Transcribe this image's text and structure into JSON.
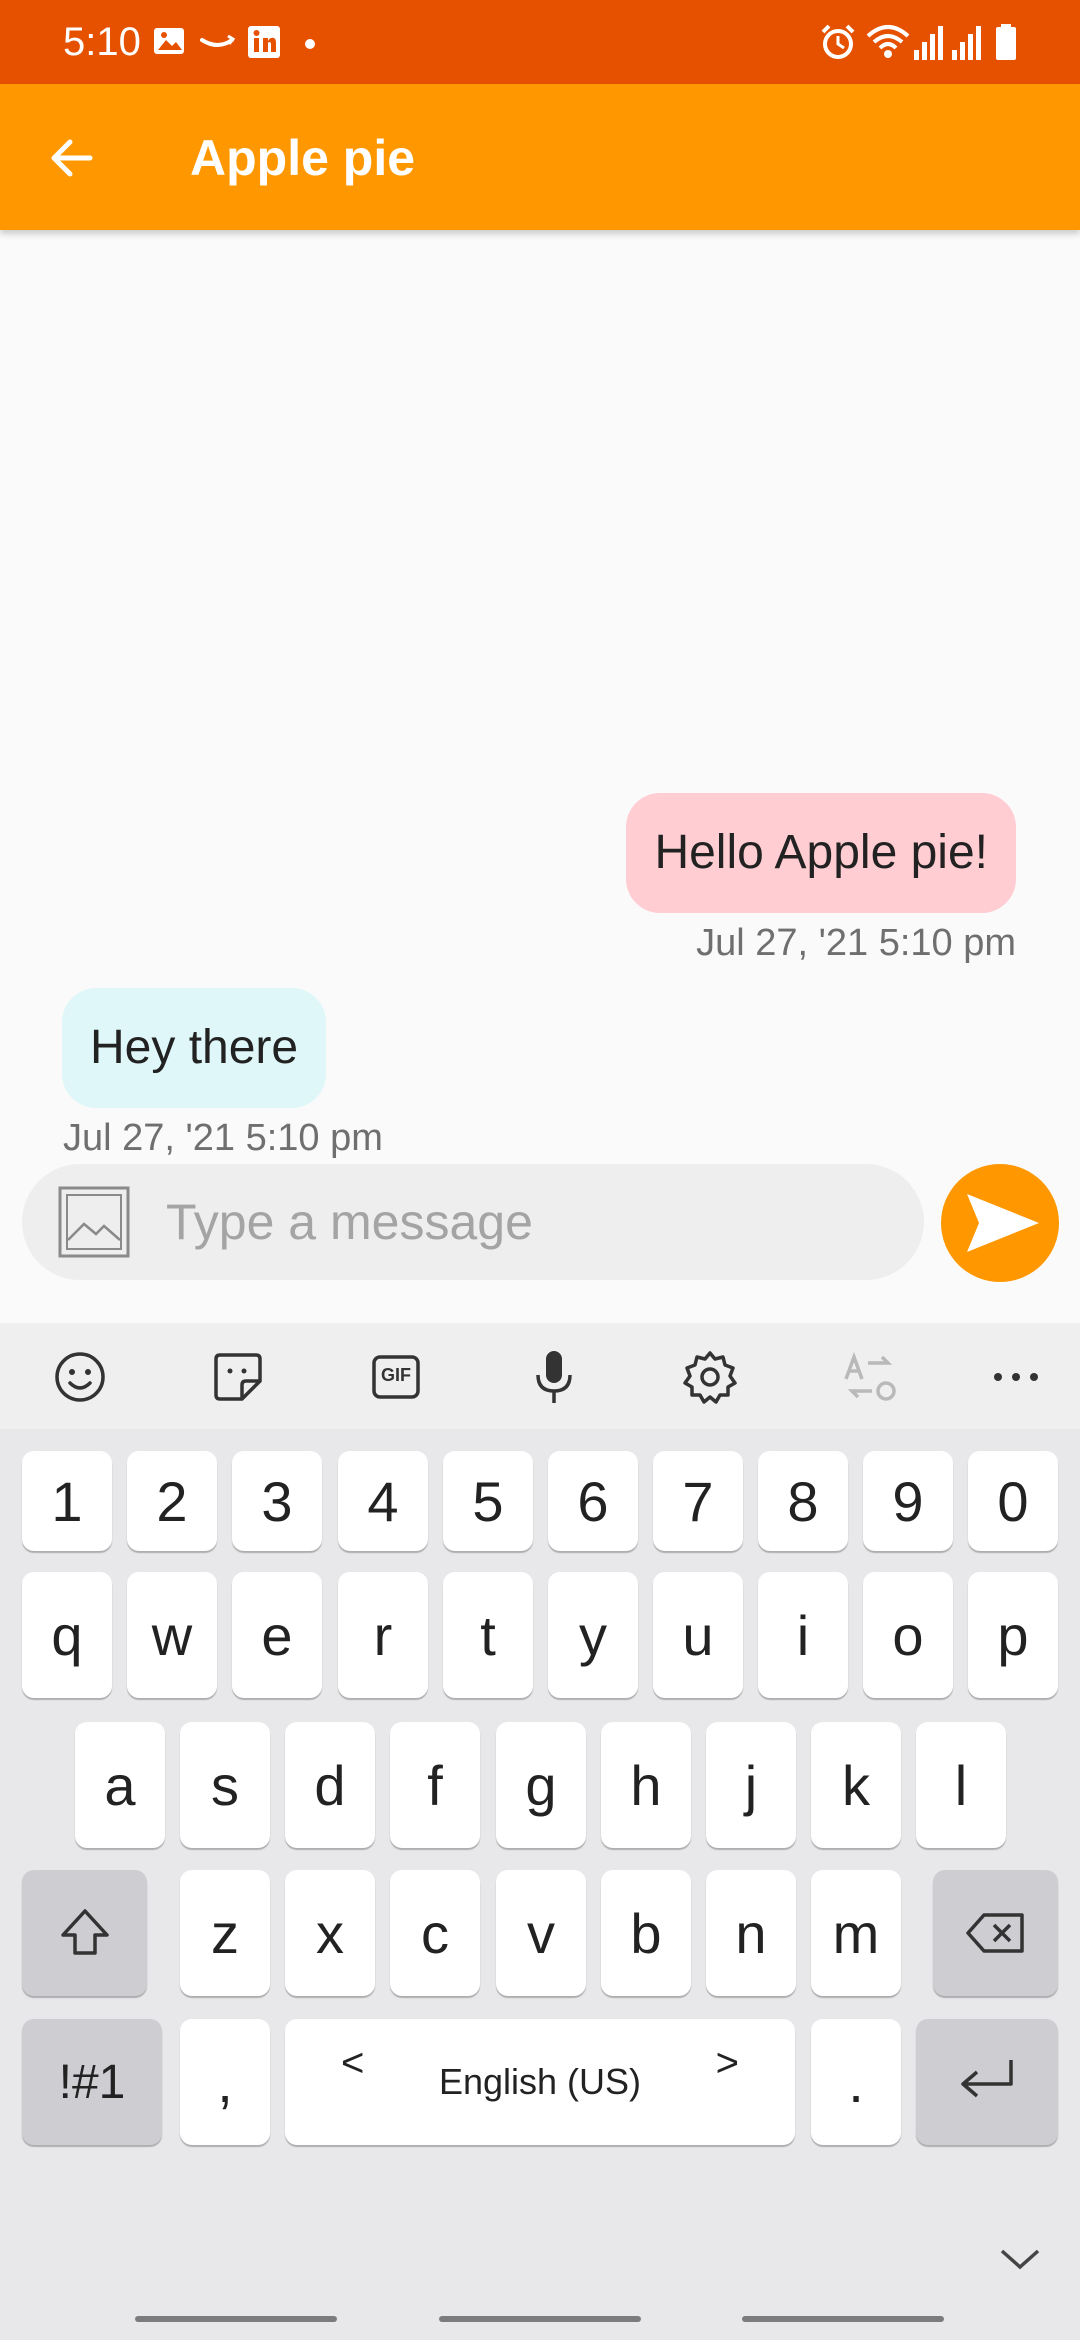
{
  "status_bar": {
    "time": "5:10",
    "left_icons": [
      "image-icon",
      "amazon-icon",
      "linkedin-icon",
      "dot-icon"
    ],
    "right_icons": [
      "alarm-icon",
      "wifi-icon",
      "signal-icon",
      "signal-icon",
      "battery-icon"
    ]
  },
  "app_bar": {
    "title": "Apple pie",
    "back_icon": "arrow-back-icon",
    "background": "#ff9800",
    "status_background": "#e65100"
  },
  "messages": [
    {
      "direction": "outgoing",
      "text": "Hello Apple pie!",
      "timestamp": "Jul 27, '21 5:10 pm",
      "bubble_color": "#ffcdd2"
    },
    {
      "direction": "incoming",
      "text": "Hey there",
      "timestamp": "Jul 27, '21 5:10 pm",
      "bubble_color": "#e0f7fa"
    }
  ],
  "composer": {
    "placeholder": "Type a message",
    "attach_icon": "image-icon",
    "send_icon": "send-icon",
    "send_color": "#ff9800"
  },
  "keyboard": {
    "toolbar": [
      "emoji-icon",
      "sticker-icon",
      "gif-icon",
      "microphone-icon",
      "settings-icon",
      "translate-icon",
      "more-icon"
    ],
    "gif_label": "GIF",
    "rows": {
      "numbers": [
        "1",
        "2",
        "3",
        "4",
        "5",
        "6",
        "7",
        "8",
        "9",
        "0"
      ],
      "row1": [
        "q",
        "w",
        "e",
        "r",
        "t",
        "y",
        "u",
        "i",
        "o",
        "p"
      ],
      "row2": [
        "a",
        "s",
        "d",
        "f",
        "g",
        "h",
        "j",
        "k",
        "l"
      ],
      "row3": [
        "z",
        "x",
        "c",
        "v",
        "b",
        "n",
        "m"
      ]
    },
    "symbols_label": "!#1",
    "comma_label": ",",
    "period_label": ".",
    "language_label": "English (US)",
    "language_prev": "<",
    "language_next": ">"
  }
}
